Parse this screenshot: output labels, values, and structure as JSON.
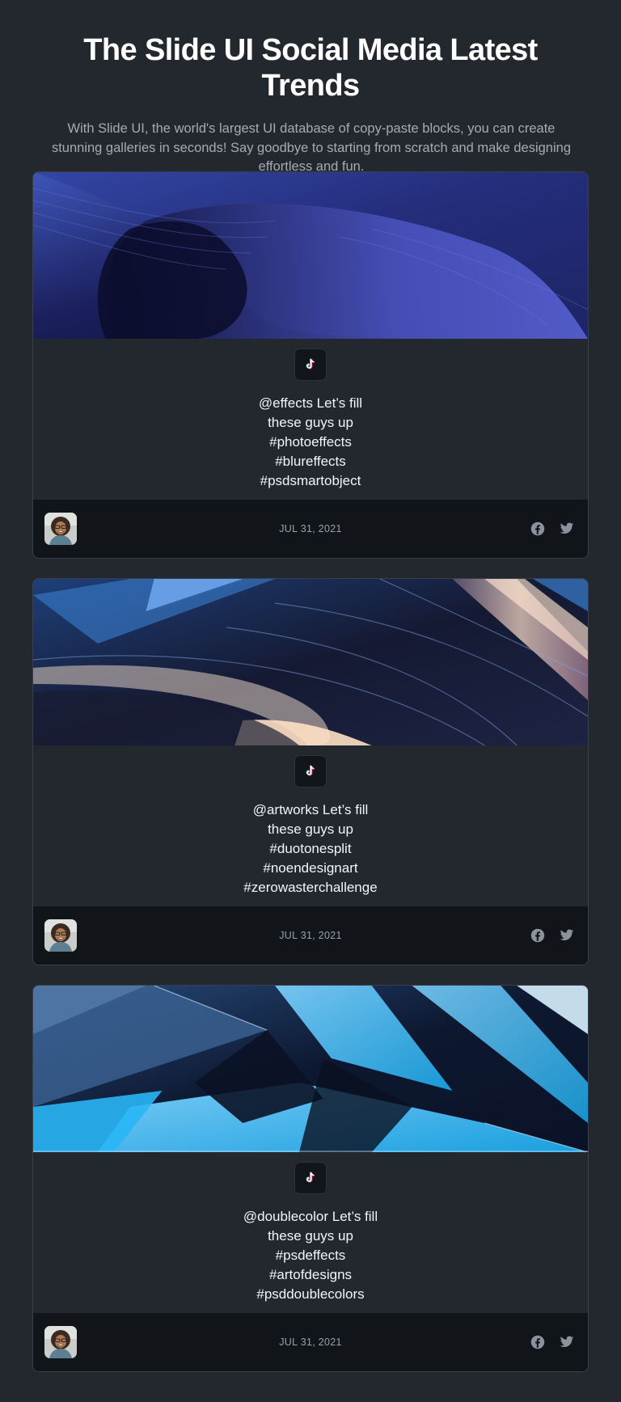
{
  "hero": {
    "title": "The Slide UI Social Media Latest Trends",
    "subtitle": "With Slide UI, the world's largest UI database of copy-paste blocks, you can create stunning galleries in seconds! Say goodbye to starting from scratch and make designing effortless and fun."
  },
  "cards": [
    {
      "caption_lines": [
        "@effects Let’s fill",
        "these guys up",
        "#photoeffects",
        "#blureffects",
        "#psdsmartobject"
      ],
      "date": "JUL 31, 2021"
    },
    {
      "caption_lines": [
        "@artworks Let’s fill",
        "these guys up",
        "#duotonesplit",
        "#noendesignart",
        "#zerowasterchallenge"
      ],
      "date": "JUL 31, 2021"
    },
    {
      "caption_lines": [
        "@doublecolor Let’s fill",
        "these guys up",
        "#psdeffects",
        "#artofdesigns",
        "#psddoublecolors"
      ],
      "date": "JUL 31, 2021"
    }
  ],
  "icons": {
    "platform": "tiktok-icon",
    "share": [
      "facebook-icon",
      "twitter-icon"
    ]
  },
  "colors": {
    "background": "#23272e",
    "footer": "#111419",
    "icon_muted": "#8c929c"
  }
}
